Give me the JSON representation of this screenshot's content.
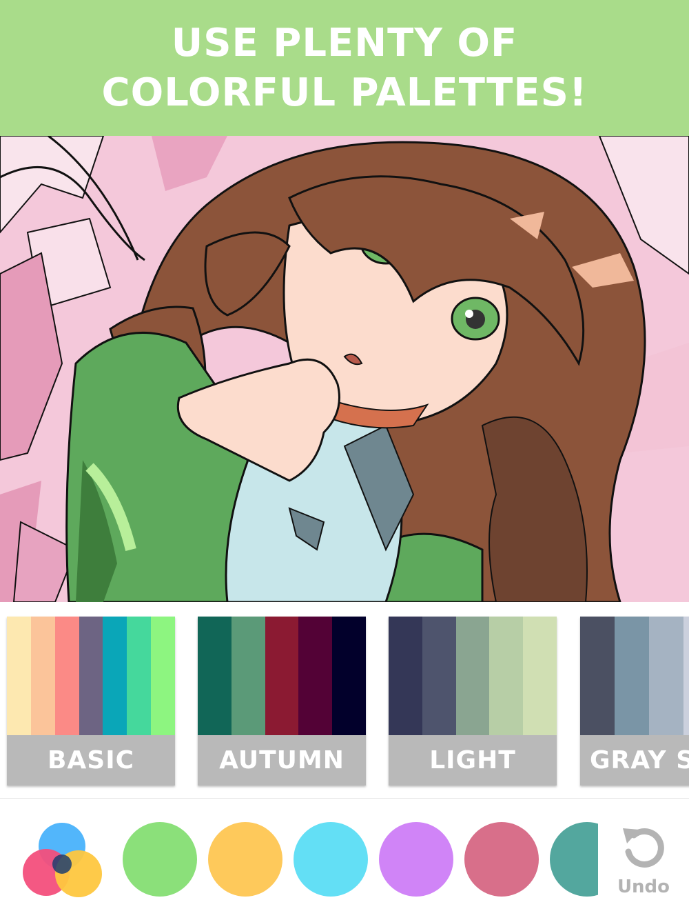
{
  "banner": {
    "line1": "USE PLENTY OF",
    "line2": "COLORFUL PALETTES!",
    "color": "#a9dc8a"
  },
  "artwork": {
    "description_icon": "anime-girl-coloring-page"
  },
  "palettes": [
    {
      "label": "BASIC",
      "colors": [
        "#fde8b0",
        "#fbc49a",
        "#fb8a86",
        "#6d6483",
        "#0aa6b8",
        "#45d89c",
        "#8df580"
      ]
    },
    {
      "label": "AUTUMN",
      "colors": [
        "#116657",
        "#5b9a78",
        "#8b1a32",
        "#530236",
        "#02002b"
      ]
    },
    {
      "label": "LIGHT",
      "colors": [
        "#343757",
        "#4e546d",
        "#8aa591",
        "#b7cea6",
        "#d0dfb3"
      ]
    },
    {
      "label": "GRAY SC",
      "colors": [
        "#4b5062",
        "#7a95a6",
        "#a5b3c2",
        "#cbd0dd"
      ]
    }
  ],
  "toolbar": {
    "mixer_icon": "color-mixer-icon",
    "colors": [
      "#8be07a",
      "#fec95b",
      "#63dff5",
      "#d084f7",
      "#d86f8a",
      "#53a79e"
    ],
    "undo_label": "Undo",
    "undo_icon": "undo-arrow-icon"
  }
}
